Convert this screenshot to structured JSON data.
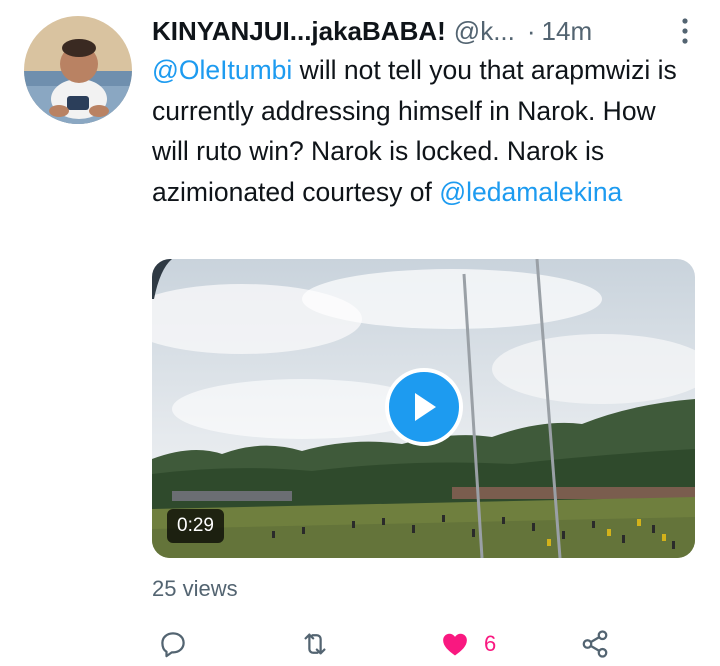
{
  "tweet": {
    "author_name": "KINYANJUI...jakaBABA!",
    "author_handle": "@k...",
    "separator": "·",
    "timestamp": "14m",
    "text": {
      "mention_1": "@OleItumbi",
      "body": " will not tell you that arapmwizi is currently addressing himself in Narok. How will ruto win? Narok is locked. Narok is azimionated courtesy of ",
      "mention_2": "@ledamalekina"
    },
    "media": {
      "type": "video",
      "duration": "0:29"
    },
    "views": "25 views",
    "actions": {
      "reply_icon": "reply-icon",
      "retweet_icon": "retweet-icon",
      "like_icon": "heart-filled-icon",
      "like_count": "6",
      "share_icon": "share-icon"
    }
  },
  "colors": {
    "accent": "#1d9bf0",
    "like": "#f91880",
    "secondary_text": "#536471",
    "primary_text": "#0f1419"
  }
}
